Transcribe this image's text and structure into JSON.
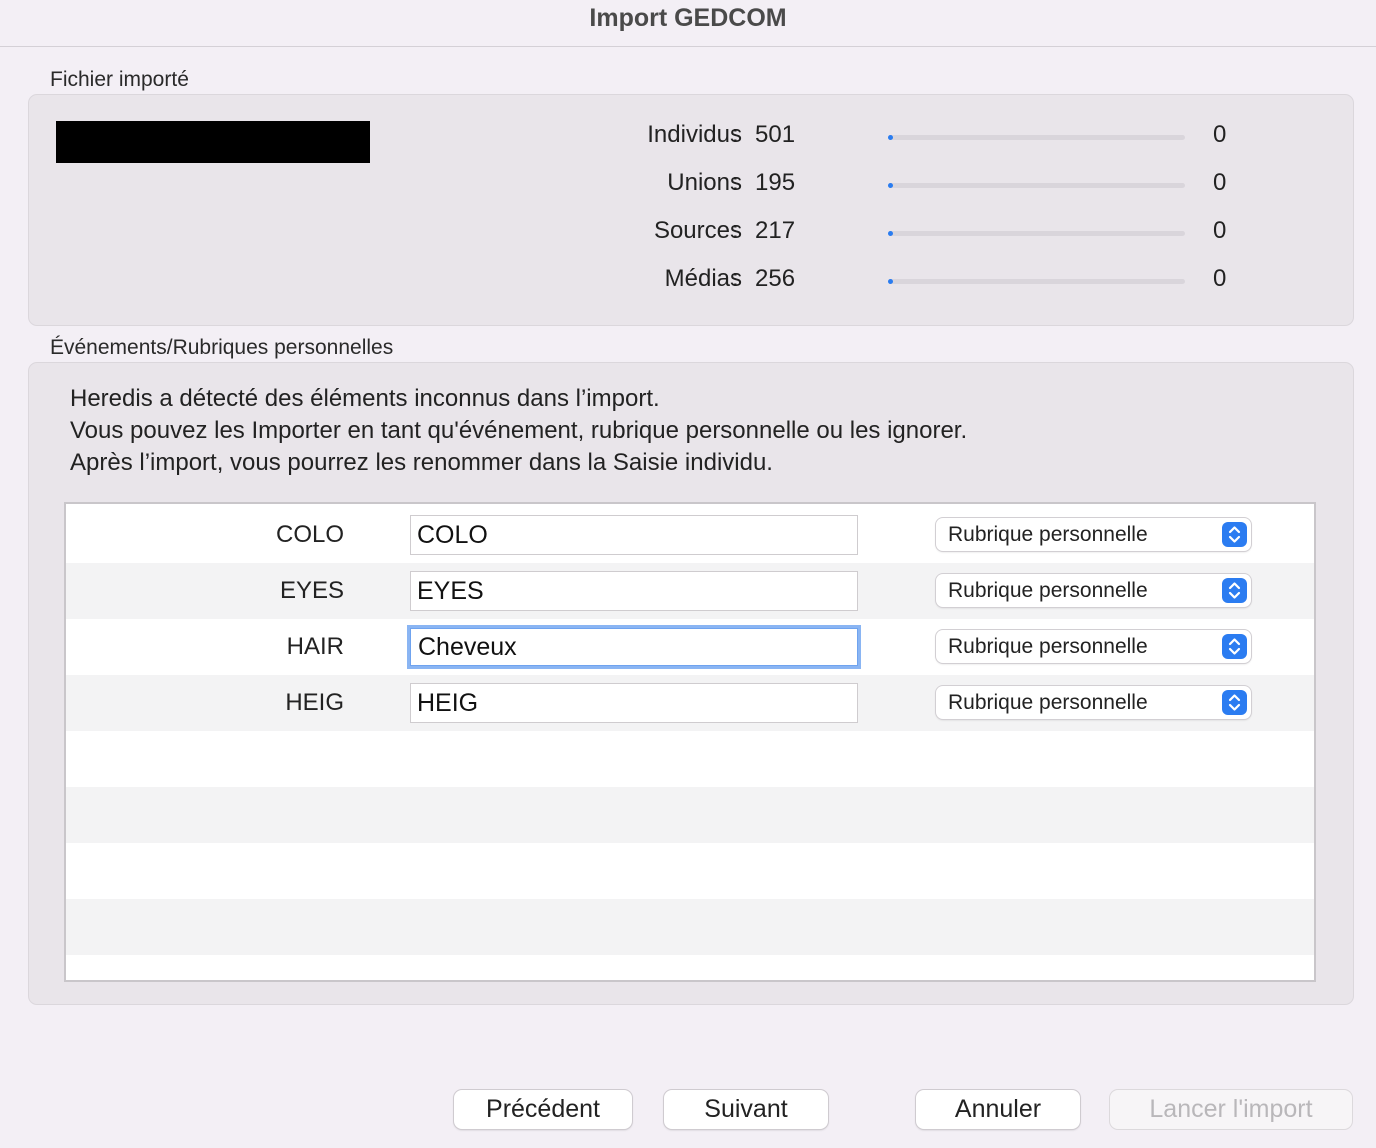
{
  "window": {
    "title": "Import GEDCOM"
  },
  "imported_file": {
    "section_label": "Fichier importé",
    "stats": [
      {
        "label": "Individus",
        "colon": ":",
        "value": "501",
        "progress": 0.0,
        "count": "0"
      },
      {
        "label": "Unions",
        "colon": ":",
        "value": "195",
        "progress": 0.0,
        "count": "0"
      },
      {
        "label": "Sources",
        "colon": ":",
        "value": "217",
        "progress": 0.0,
        "count": "0"
      },
      {
        "label": "Médias",
        "colon": ":",
        "value": "256",
        "progress": 0.0,
        "count": "0"
      }
    ],
    "progress_color": "#2a7cf0"
  },
  "events": {
    "section_label": "Événements/Rubriques personnelles",
    "info_lines": [
      "Heredis a détecté des éléments inconnus dans l’import.",
      "Vous pouvez les Importer en tant qu'événement, rubrique personnelle ou les ignorer.",
      "Après l’import, vous pourrez les renommer dans la Saisie individu."
    ],
    "rows": [
      {
        "tag": "COLO",
        "name": "COLO",
        "type": "Rubrique personnelle"
      },
      {
        "tag": "EYES",
        "name": "EYES",
        "type": "Rubrique personnelle"
      },
      {
        "tag": "HAIR",
        "name": "Cheveux",
        "type": "Rubrique personnelle"
      },
      {
        "tag": "HEIG",
        "name": "HEIG",
        "type": "Rubrique personnelle"
      }
    ]
  },
  "buttons": {
    "previous": "Précédent",
    "next": "Suivant",
    "cancel": "Annuler",
    "launch": "Lancer l'import"
  }
}
